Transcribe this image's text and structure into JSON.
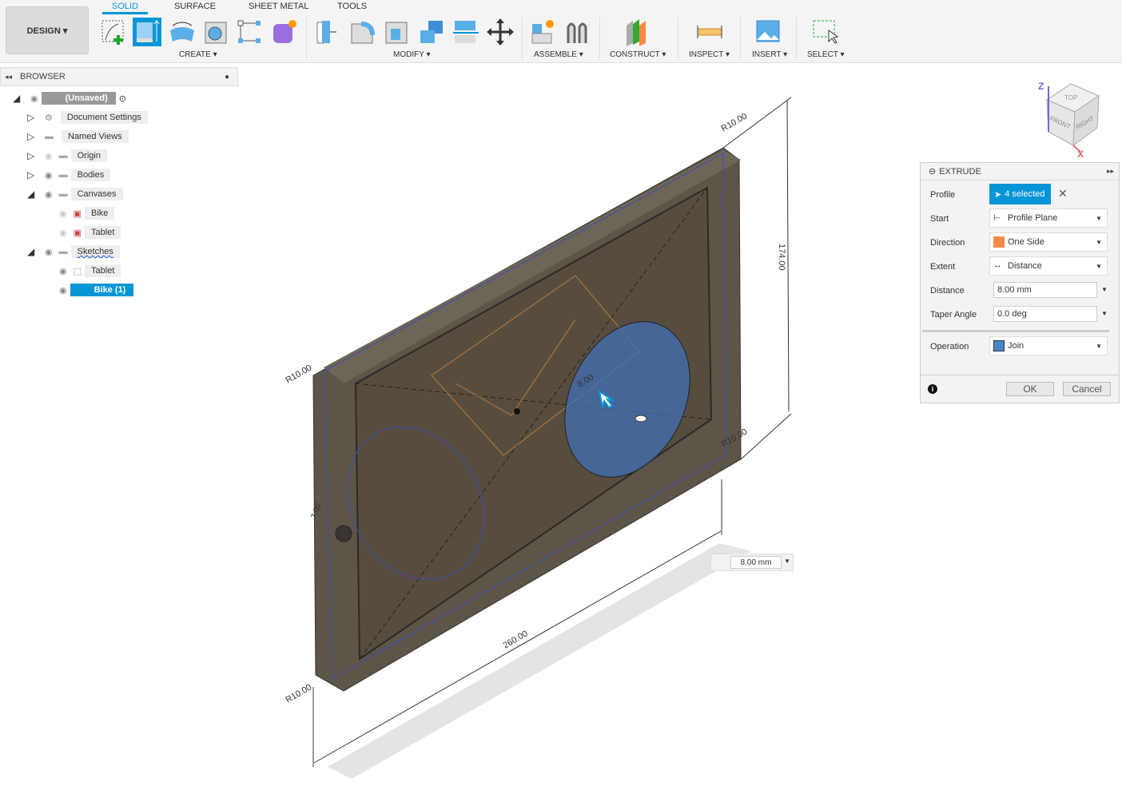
{
  "toolbar": {
    "workspace": "DESIGN ▾",
    "tabs": [
      {
        "label": "SOLID",
        "active": true
      },
      {
        "label": "SURFACE"
      },
      {
        "label": "SHEET METAL"
      },
      {
        "label": "TOOLS"
      }
    ],
    "groups": [
      "CREATE ▾",
      "MODIFY ▾",
      "ASSEMBLE ▾",
      "CONSTRUCT ▾",
      "INSPECT ▾",
      "INSERT ▾",
      "SELECT ▾"
    ],
    "accent": "#0696d7"
  },
  "browser": {
    "title": "BROWSER",
    "items": [
      {
        "label": "(Unsaved)"
      },
      {
        "label": "Document Settings"
      },
      {
        "label": "Named Views"
      },
      {
        "label": "Origin"
      },
      {
        "label": "Bodies"
      },
      {
        "label": "Canvases"
      },
      {
        "label": "Bike"
      },
      {
        "label": "Tablet"
      },
      {
        "label": "Sketches"
      },
      {
        "label": "Tablet"
      },
      {
        "label": "Bike (1)",
        "selected": true
      }
    ]
  },
  "viewcube": {
    "top": "TOP",
    "front": "FRONT",
    "right": "RIGHT",
    "z": "Z",
    "x": "X"
  },
  "dimensions": {
    "r1": "R10.00",
    "r2": "R10.00",
    "r3": "R10.00",
    "r4": "R10.00",
    "height": "174.00",
    "width": "260.00",
    "inner": "8.00",
    "side": "7.00"
  },
  "inline_input": {
    "value": "8.00 mm"
  },
  "extrude": {
    "title": "EXTRUDE",
    "profile_label": "Profile",
    "profile_value": "4 selected",
    "start_label": "Start",
    "start_value": "Profile Plane",
    "direction_label": "Direction",
    "direction_value": "One Side",
    "extent_label": "Extent",
    "extent_value": "Distance",
    "distance_label": "Distance",
    "distance_value": "8.00 mm",
    "taper_label": "Taper Angle",
    "taper_value": "0.0 deg",
    "operation_label": "Operation",
    "operation_value": "Join",
    "ok": "OK",
    "cancel": "Cancel"
  }
}
